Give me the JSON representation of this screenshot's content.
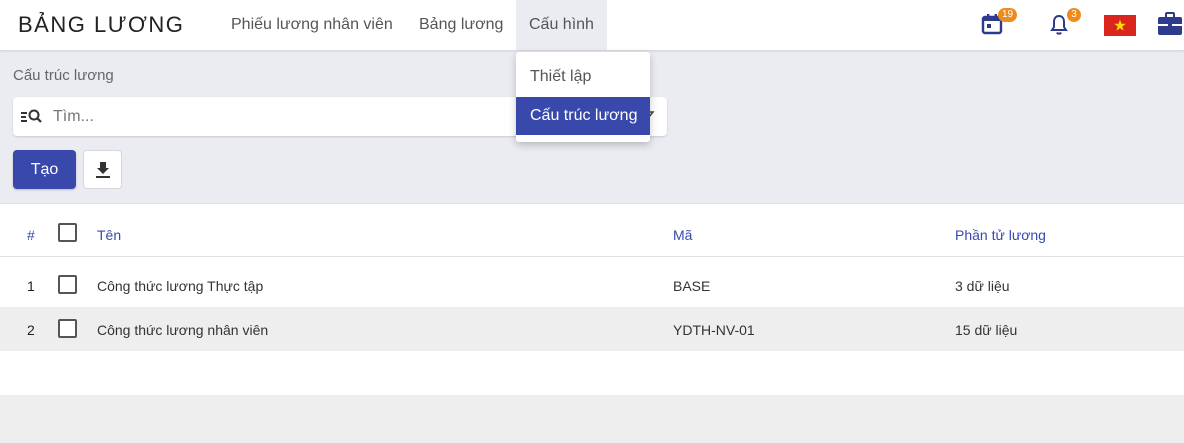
{
  "app": {
    "title": "BẢNG LƯƠNG"
  },
  "nav": {
    "items": [
      {
        "label": "Phiếu lương nhân viên"
      },
      {
        "label": "Bảng lương"
      },
      {
        "label": "Cấu hình"
      }
    ],
    "active_index": 2
  },
  "top_icons": {
    "calendar_badge": "19",
    "notification_badge": "3",
    "flag": "vietnam-flag-icon",
    "apps": "briefcase-icon"
  },
  "dropdown": {
    "items": [
      {
        "label": "Thiết lập"
      },
      {
        "label": "Cấu trúc lương"
      }
    ],
    "selected_index": 1
  },
  "page": {
    "section_label": "Cấu trúc lương",
    "search_placeholder": "Tìm...",
    "create_label": "Tạo"
  },
  "table": {
    "headers": {
      "index": "#",
      "name": "Tên",
      "code": "Mã",
      "elements": "Phần tử lương"
    },
    "rows": [
      {
        "index": "1",
        "name": "Công thức lương Thực tập",
        "code": "BASE",
        "elements": "3 dữ liệu"
      },
      {
        "index": "2",
        "name": "Công thức lương nhân viên",
        "code": "YDTH-NV-01",
        "elements": "15 dữ liệu"
      }
    ]
  },
  "colors": {
    "primary": "#3949ab",
    "badge": "#ef8b1e",
    "background": "#eaecf2"
  }
}
